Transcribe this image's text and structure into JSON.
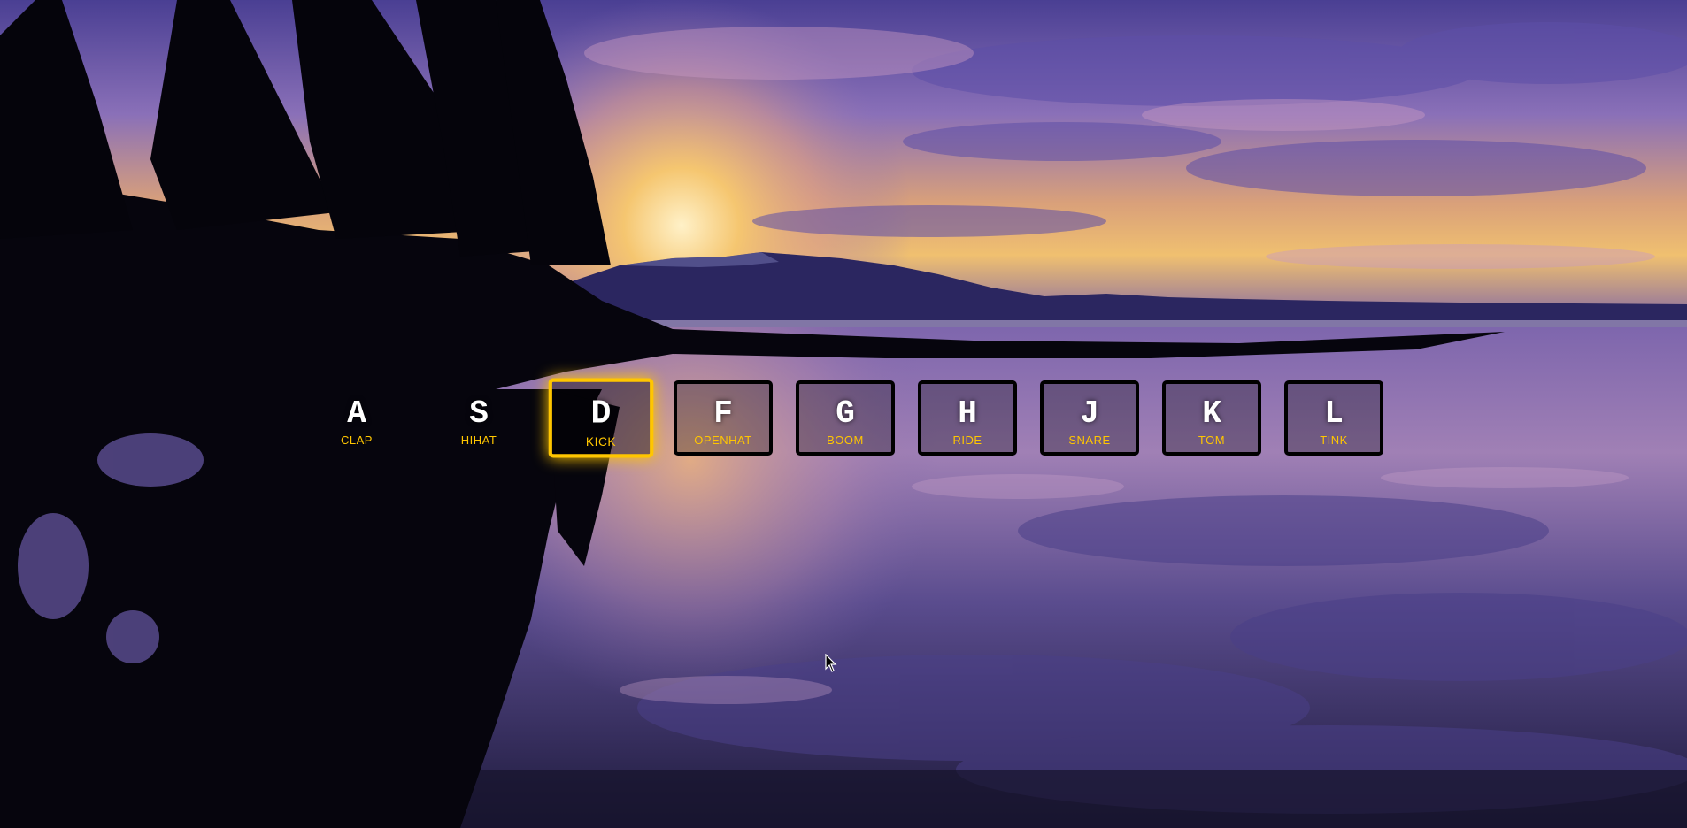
{
  "keys": [
    {
      "key": "A",
      "sound": "clap",
      "state": "idle",
      "framed": false
    },
    {
      "key": "S",
      "sound": "hihat",
      "state": "idle",
      "framed": false
    },
    {
      "key": "D",
      "sound": "kick",
      "state": "playing",
      "framed": true
    },
    {
      "key": "F",
      "sound": "openhat",
      "state": "idle",
      "framed": true
    },
    {
      "key": "G",
      "sound": "boom",
      "state": "idle",
      "framed": true
    },
    {
      "key": "H",
      "sound": "ride",
      "state": "idle",
      "framed": true
    },
    {
      "key": "J",
      "sound": "snare",
      "state": "idle",
      "framed": true
    },
    {
      "key": "K",
      "sound": "tom",
      "state": "idle",
      "framed": true
    },
    {
      "key": "L",
      "sound": "tink",
      "state": "idle",
      "framed": true
    }
  ],
  "colors": {
    "accent": "#ffc600",
    "key_text": "#ffffff",
    "key_border": "#000000"
  },
  "background": {
    "subject": "sunset over lake with silhouetted pine trees and mountains"
  },
  "cursor": {
    "icon": "mouse-pointer-icon"
  }
}
